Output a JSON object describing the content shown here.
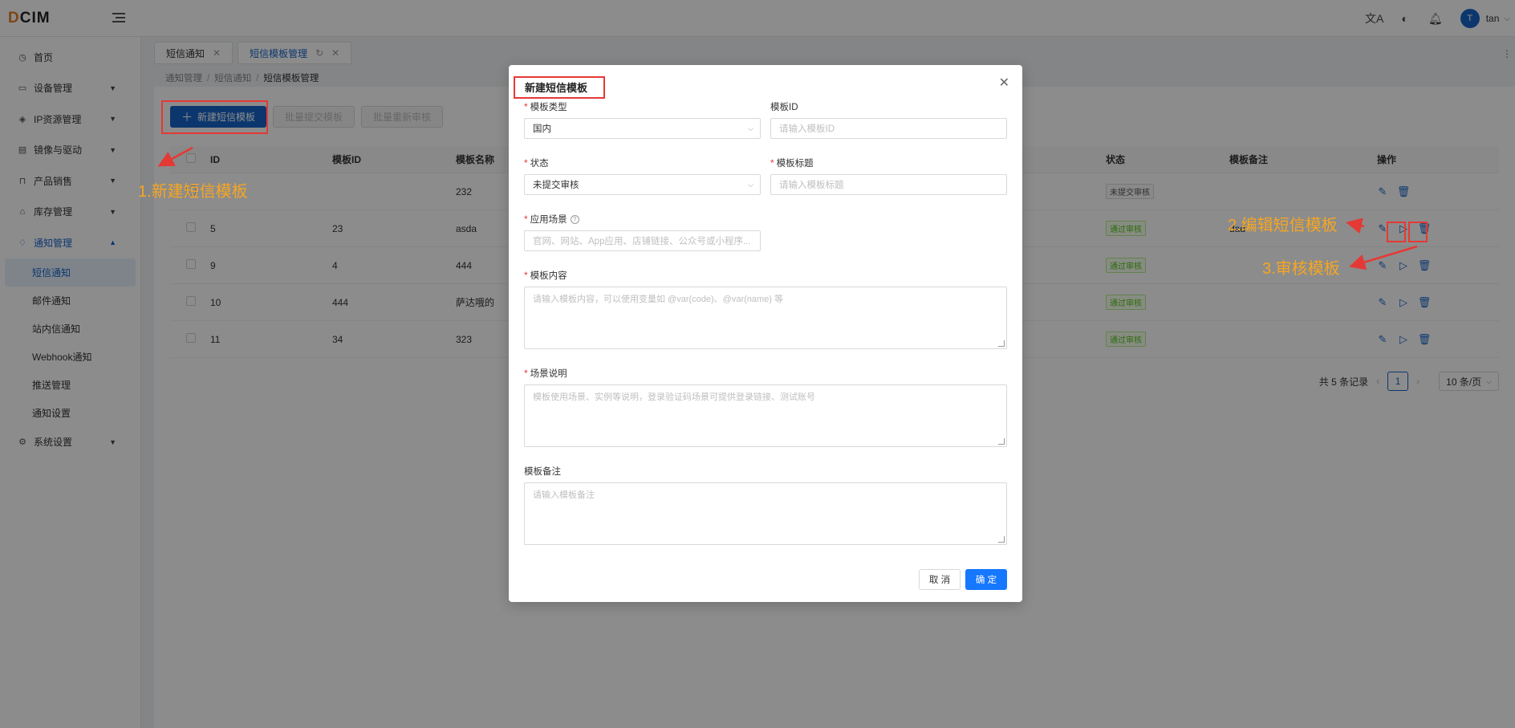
{
  "app": {
    "logo_prefix": "D",
    "logo_rest": "CIM",
    "user_initial": "T",
    "username": "tan"
  },
  "sidebar": {
    "items": [
      {
        "label": "首页",
        "icon": "dashboard-icon"
      },
      {
        "label": "设备管理",
        "icon": "monitor-icon"
      },
      {
        "label": "IP资源管理",
        "icon": "network-icon"
      },
      {
        "label": "镜像与驱动",
        "icon": "document-icon"
      },
      {
        "label": "产品销售",
        "icon": "bag-icon"
      },
      {
        "label": "库存管理",
        "icon": "warehouse-icon"
      },
      {
        "label": "通知管理",
        "icon": "bell-icon"
      }
    ],
    "submenu": [
      "短信通知",
      "邮件通知",
      "站内信通知",
      "Webhook通知",
      "推送管理",
      "通知设置"
    ],
    "system": {
      "label": "系统设置",
      "icon": "gear-icon"
    }
  },
  "tabs": [
    {
      "label": "短信通知"
    },
    {
      "label": "短信模板管理"
    }
  ],
  "breadcrumb": [
    "通知管理",
    "短信通知",
    "短信模板管理"
  ],
  "toolbar": {
    "create_label": "新建短信模板",
    "batch_submit_label": "批量提交模板",
    "batch_review_label": "批量重新审核"
  },
  "table": {
    "headers": {
      "id": "ID",
      "template_id": "模板ID",
      "name": "模板名称",
      "status": "状态",
      "remark": "模板备注",
      "ops": "操作"
    },
    "rows": [
      {
        "id": "",
        "template_id": "",
        "name": "232",
        "status": "未提交审核",
        "remark": ""
      },
      {
        "id": "5",
        "template_id": "23",
        "name": "asda",
        "status": "通过审核",
        "remark": "dad"
      },
      {
        "id": "9",
        "template_id": "4",
        "name": "444",
        "status": "通过审核",
        "remark": ""
      },
      {
        "id": "10",
        "template_id": "444",
        "name": "萨达哦的",
        "status": "通过审核",
        "remark": ""
      },
      {
        "id": "11",
        "template_id": "34",
        "name": "323",
        "status": "通过审核",
        "remark": ""
      }
    ]
  },
  "pagination": {
    "total": "共 5 条记录",
    "page": "1",
    "page_size": "10 条/页"
  },
  "modal": {
    "title": "新建短信模板",
    "type_label": "模板类型",
    "type_value": "国内",
    "tid_label": "模板ID",
    "tid_placeholder": "请输入模板ID",
    "status_label": "状态",
    "status_value": "未提交审核",
    "title_label": "模板标题",
    "title_placeholder": "请输入模板标题",
    "scene_label": "应用场景",
    "scene_placeholder": "官网、网站、App应用、店铺链接、公众号或小程序...",
    "content_label": "模板内容",
    "content_placeholder": "请输入模板内容，可以使用变量如 @var(code)、@var(name) 等",
    "desc_label": "场景说明",
    "desc_placeholder": "模板使用场景、实例等说明，登录验证码场景可提供登录链接、测试账号",
    "remark_label": "模板备注",
    "remark_placeholder": "请输入模板备注",
    "cancel_label": "取 消",
    "ok_label": "确 定"
  },
  "annotations": {
    "step1": "1.新建短信模板",
    "step2": "2.编辑短信模板",
    "step3": "3.审核模板"
  },
  "colors": {
    "primary": "#1765c9",
    "annotation": "#f5a623",
    "highlight": "#e53935"
  }
}
